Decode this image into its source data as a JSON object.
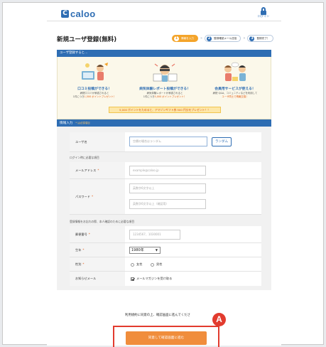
{
  "header": {
    "logo_mark": "C",
    "logo_text": "caloo",
    "login_label": "ログイン"
  },
  "page_title": "新規ユーザ登録(無料)",
  "steps": [
    {
      "num": "1",
      "label": "情報を入力",
      "state": "active"
    },
    {
      "num": "2",
      "label": "登録確認メール送信",
      "state": "todo"
    },
    {
      "num": "3",
      "label": "登録完了！",
      "state": "todo"
    }
  ],
  "step_arrow": "»",
  "banner": {
    "heading": "ユーザ登録すると…",
    "features": [
      {
        "title": "口コミ投稿ができる！",
        "desc1": "病院口コミが承認されると",
        "desc2_pre": "1件につき",
        "desc2_hl": "1,500 ポイントプレゼント！",
        "icon": "review-illustration"
      },
      {
        "title": "病気体験レポート投稿ができる！",
        "desc1": "病気体験レポートが承認されると",
        "desc2_pre": "1件につき",
        "desc2_hl": "5,000 ポイントプレゼント！",
        "icon": "report-illustration"
      },
      {
        "title": "会員用サービスが使える！",
        "desc1": "病院 Q&A、コミュニティなどを利用して",
        "desc2_pre": "",
        "desc2_hl": "ユーザ同士で情報交換！",
        "icon": "community-illustration"
      }
    ],
    "promo": "5,000 ポイントをためると、アマゾンギフト券 500 円分をプレゼント！！"
  },
  "form": {
    "heading": "情報入力",
    "required_note": "* は必須項目",
    "username_label": "ユーザ名",
    "username_placeholder": "空欄の場合はランダム",
    "random_button": "ランダム",
    "login_section_note": "ログイン時に必要な項目",
    "email_label": "メールアドレス",
    "email_placeholder": "example@caloo.jp",
    "password_label": "パスワード",
    "password_placeholder": "英数字6文字以上",
    "password_confirm_placeholder": "英数字6文字以上（確認用）",
    "identity_section_note": "登録情報をお忘れの際、本人確認のために必要な項目",
    "postal_label": "郵便番号",
    "postal_placeholder": "1234567、1030001",
    "birth_year_label": "生年",
    "birth_year_value": "1980年",
    "gender_label": "性別",
    "gender_options": [
      "女性",
      "男性"
    ],
    "newsletter_label": "お知らせメール",
    "newsletter_checkbox": "メールマガジンを受け取る",
    "required_mark": "*"
  },
  "agree_text": "利用規約に同意の上、確認画面に進んでくださ",
  "submit_label": "同意して確認画面に進む",
  "marker_label": "A",
  "colors": {
    "brand_blue": "#2e6db3",
    "accent_orange": "#f08d3c",
    "highlight_red": "#e23b2e"
  }
}
